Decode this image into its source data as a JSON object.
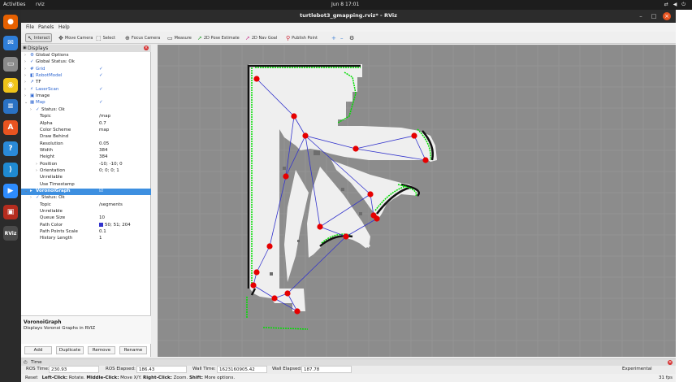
{
  "topbar": {
    "activities": "Activities",
    "app": "rviz",
    "clock": "Jun 8  17:01"
  },
  "dock": {
    "apps": [
      {
        "name": "firefox-icon",
        "color": "#e66000",
        "glyph": "●"
      },
      {
        "name": "mail-icon",
        "color": "#2f7ed8",
        "glyph": "✉"
      },
      {
        "name": "files-icon",
        "color": "#8a8a8a",
        "glyph": "▭"
      },
      {
        "name": "rhythmbox-icon",
        "color": "#f0c419",
        "glyph": "◉"
      },
      {
        "name": "writer-icon",
        "color": "#2a72c4",
        "glyph": "≡"
      },
      {
        "name": "software-icon",
        "color": "#e95420",
        "glyph": "A"
      },
      {
        "name": "help-icon",
        "color": "#2a8ad8",
        "glyph": "?"
      },
      {
        "name": "vscode-icon",
        "color": "#1f8ad2",
        "glyph": "⟩"
      },
      {
        "name": "zoom-icon",
        "color": "#2d8cff",
        "glyph": "▶"
      },
      {
        "name": "terminal-icon",
        "color": "#b52c1e",
        "glyph": "▣"
      },
      {
        "name": "rviz-icon",
        "color": "#4a4a4a",
        "glyph": "RViz"
      }
    ]
  },
  "window": {
    "title": "turtlebot3_gmapping.rviz* - RViz"
  },
  "menu": {
    "file": "File",
    "panels": "Panels",
    "help": "Help"
  },
  "toolbar": {
    "interact": "Interact",
    "move_camera": "Move Camera",
    "select": "Select",
    "focus_camera": "Focus Camera",
    "measure": "Measure",
    "pose_estimate": "2D Pose Estimate",
    "nav_goal": "2D Nav Goal",
    "publish_point": "Publish Point"
  },
  "displays": {
    "title": "Displays",
    "rows": [
      {
        "label": "Global Options",
        "indent": 0,
        "arrow": "›",
        "icon": "⚙"
      },
      {
        "label": "Global Status: Ok",
        "indent": 0,
        "arrow": "›",
        "icon": "✓"
      },
      {
        "label": "Grid",
        "indent": 0,
        "arrow": "›",
        "icon": "#",
        "blue": true,
        "value": "✓"
      },
      {
        "label": "RobotModel",
        "indent": 0,
        "arrow": "›",
        "icon": "◧",
        "blue": true,
        "value": "✓"
      },
      {
        "label": "TF",
        "indent": 0,
        "arrow": "›",
        "icon": "↗"
      },
      {
        "label": "LaserScan",
        "indent": 0,
        "arrow": "›",
        "icon": "⚡",
        "blue": true,
        "value": "✓"
      },
      {
        "label": "Image",
        "indent": 0,
        "arrow": "›",
        "icon": "▣"
      },
      {
        "label": "Map",
        "indent": 0,
        "arrow": "⌄",
        "icon": "▦",
        "blue": true,
        "value": "✓"
      },
      {
        "label": "Status: Ok",
        "indent": 1,
        "arrow": "›",
        "icon": "✓"
      },
      {
        "label": "Topic",
        "indent": 2,
        "value": "/map"
      },
      {
        "label": "Alpha",
        "indent": 2,
        "value": "0.7"
      },
      {
        "label": "Color Scheme",
        "indent": 2,
        "value": "map"
      },
      {
        "label": "Draw Behind",
        "indent": 2,
        "value": ""
      },
      {
        "label": "Resolution",
        "indent": 2,
        "value": "0.05"
      },
      {
        "label": "Width",
        "indent": 2,
        "value": "384"
      },
      {
        "label": "Height",
        "indent": 2,
        "value": "384"
      },
      {
        "label": "Position",
        "indent": 2,
        "arrow": "›",
        "value": "-10; -10; 0"
      },
      {
        "label": "Orientation",
        "indent": 2,
        "arrow": "›",
        "value": "0; 0; 0; 1"
      },
      {
        "label": "Unreliable",
        "indent": 2,
        "value": ""
      },
      {
        "label": "Use Timestamp",
        "indent": 2,
        "value": ""
      },
      {
        "label": "VoronoiGraph",
        "indent": 0,
        "arrow": "⌄",
        "icon": "▸",
        "selected": true,
        "value": "☑"
      },
      {
        "label": "Status: Ok",
        "indent": 1,
        "arrow": "›",
        "icon": "✓"
      },
      {
        "label": "Topic",
        "indent": 2,
        "value": "/segments"
      },
      {
        "label": "Unreliable",
        "indent": 2,
        "value": ""
      },
      {
        "label": "Queue Size",
        "indent": 2,
        "value": "10"
      },
      {
        "label": "Path Color",
        "indent": 2,
        "value": "50; 51; 204",
        "swatch": "#3233cc"
      },
      {
        "label": "Path Points Scale",
        "indent": 2,
        "value": "0.1"
      },
      {
        "label": "History Length",
        "indent": 2,
        "value": "1"
      }
    ],
    "description_title": "VoronoiGraph",
    "description_text": "Displays Voronoi Graphs in RVIZ",
    "buttons": {
      "add": "Add",
      "duplicate": "Duplicate",
      "remove": "Remove",
      "rename": "Rename"
    }
  },
  "time": {
    "title": "Time",
    "ros_time_label": "ROS Time:",
    "ros_time": "230.93",
    "ros_elapsed_label": "ROS Elapsed:",
    "ros_elapsed": "186.43",
    "wall_time_label": "Wall Time:",
    "wall_time": "1623160905.42",
    "wall_elapsed_label": "Wall Elapsed:",
    "wall_elapsed": "187.78",
    "experimental": "Experimental"
  },
  "status": {
    "reset": "Reset",
    "hint_left_key": "Left-Click:",
    "hint_left": "Rotate.",
    "hint_middle_key": "Middle-Click:",
    "hint_middle": "Move X/Y.",
    "hint_right_key": "Right-Click:",
    "hint_right": "Zoom.",
    "hint_shift_key": "Shift:",
    "hint_shift": "More options.",
    "fps": "31 fps"
  },
  "map": {
    "voronoi_color": "#3233cc",
    "node_color": "#e60000",
    "wall_color": "#111111",
    "laser_color": "#00dd00"
  }
}
